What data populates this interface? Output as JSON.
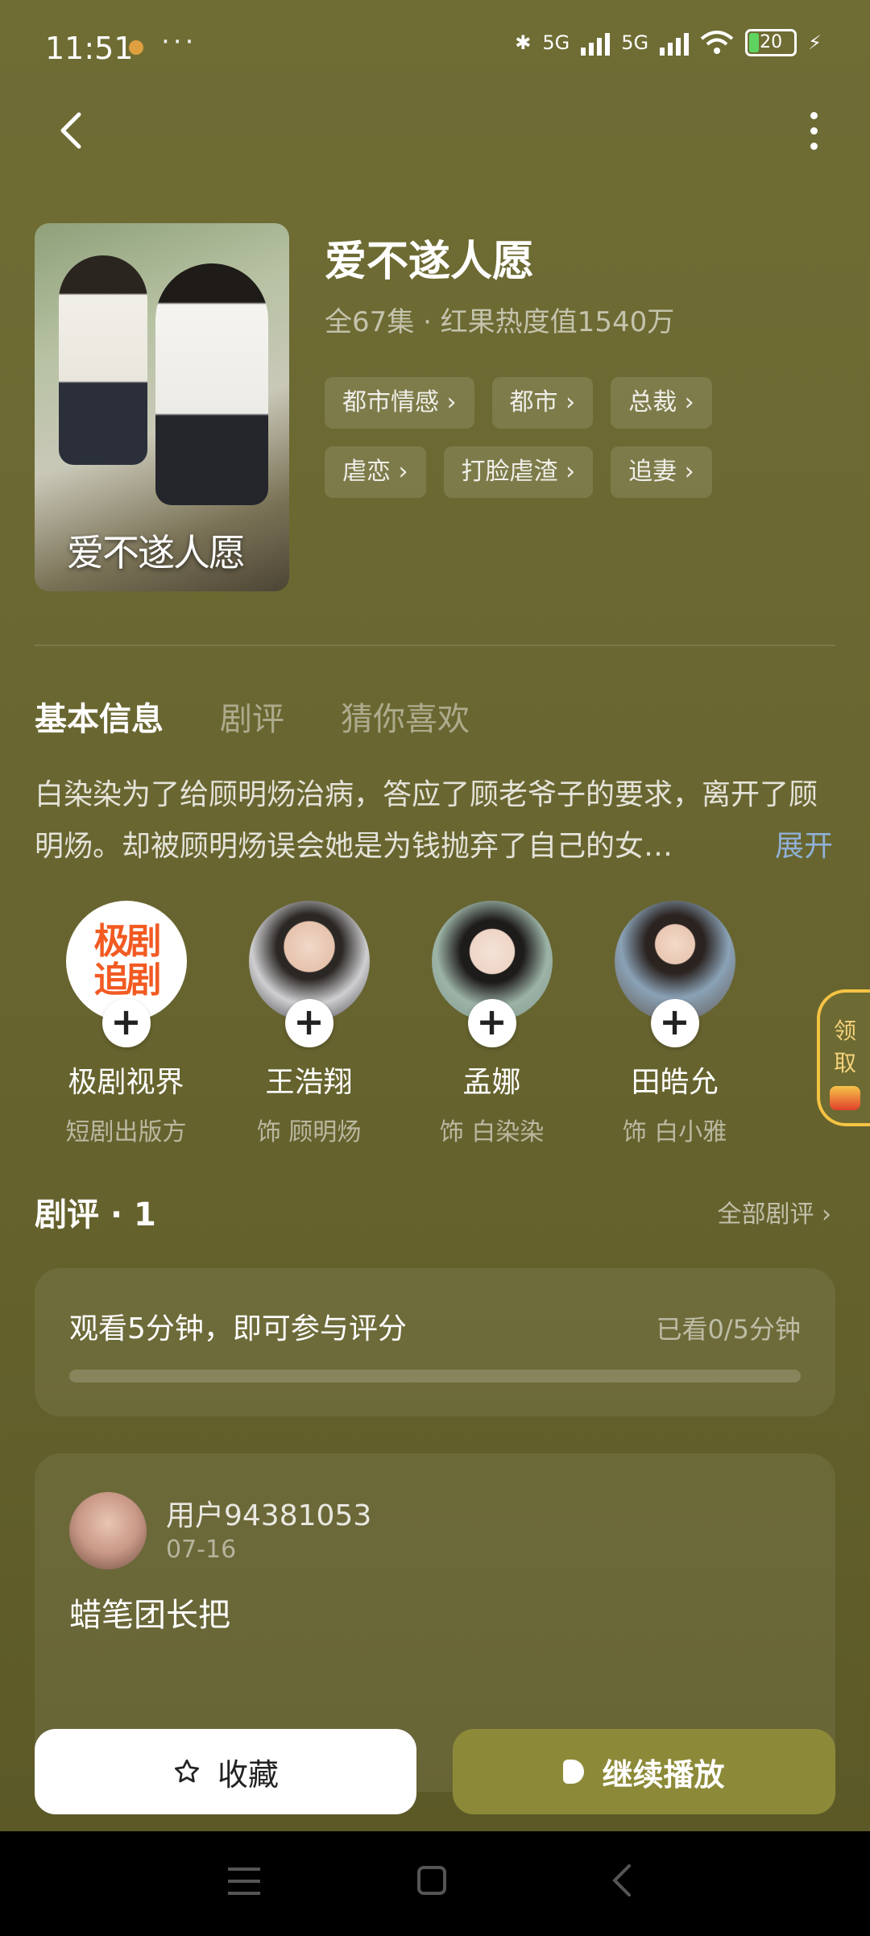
{
  "status_bar": {
    "time": "11:51",
    "dots": "···",
    "network1": "5G",
    "network2": "5G",
    "battery": "20"
  },
  "drama": {
    "poster_title": "爱不遂人愿",
    "title": "爱不遂人愿",
    "meta": "全67集 · 红果热度值1540万",
    "tags": [
      "都市情感 ›",
      "都市 ›",
      "总裁 ›",
      "虐恋 ›",
      "打脸虐渣 ›",
      "追妻 ›"
    ]
  },
  "tabs": [
    "基本信息",
    "剧评",
    "猜你喜欢"
  ],
  "synopsis": {
    "text": "白染染为了给顾明炀治病，答应了顾老爷子的要求，离开了顾明炀。却被顾明炀误会她是为钱抛弃了自己的女…",
    "expand_label": "展开"
  },
  "cast": [
    {
      "name": "极剧视界",
      "role": "短剧出版方",
      "logo_text": "极剧追剧"
    },
    {
      "name": "王浩翔",
      "role": "饰 顾明炀"
    },
    {
      "name": "孟娜",
      "role": "饰 白染染"
    },
    {
      "name": "田皓允",
      "role": "饰 白小雅"
    }
  ],
  "reward": {
    "line1": "领",
    "line2": "取"
  },
  "reviews": {
    "title": "剧评 · 1",
    "all_label": "全部剧评 ›",
    "rate_prompt": "观看5分钟，即可参与评分",
    "watched": "已看0/5分钟",
    "watched_progress": 0,
    "comment": {
      "user": "用户94381053",
      "date": "07-16",
      "text": "蜡笔团长把"
    }
  },
  "actions": {
    "favorite": "收藏",
    "play": "继续播放"
  }
}
